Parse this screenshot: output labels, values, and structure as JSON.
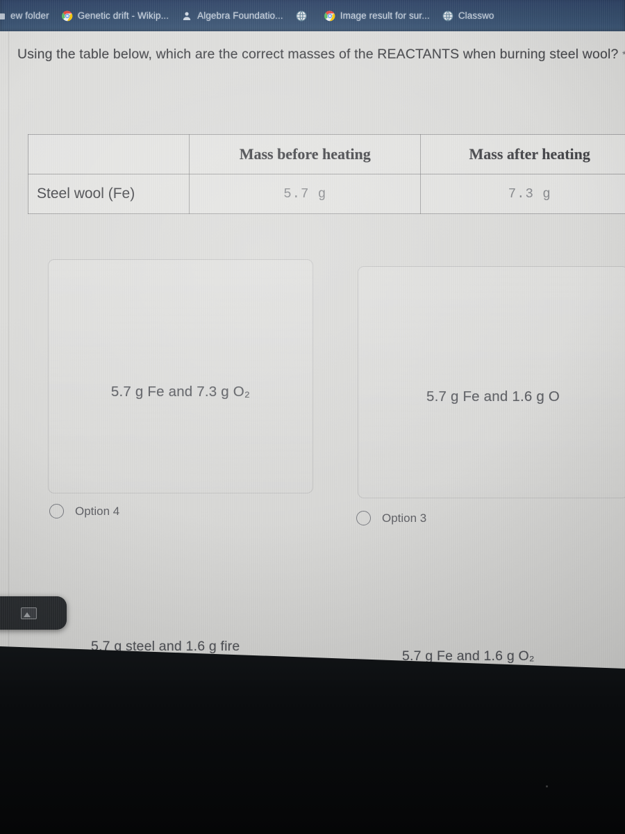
{
  "browser": {
    "bookmarks": [
      {
        "label": "ew folder",
        "icon": "folder-icon"
      },
      {
        "label": "Genetic drift - Wikip...",
        "icon": "chrome-icon"
      },
      {
        "label": "Algebra Foundatio...",
        "icon": "person-icon"
      },
      {
        "label": "",
        "icon": "globe-icon"
      },
      {
        "label": "Image result for sur...",
        "icon": "chrome-icon"
      },
      {
        "label": "Classwo",
        "icon": "globe-icon"
      }
    ]
  },
  "question": {
    "text": "Using the table below, which are the correct masses of the REACTANTS when burning steel wool?",
    "required_marker": "*"
  },
  "table": {
    "headers": [
      "",
      "Mass before heating",
      "Mass after heating"
    ],
    "rows": [
      {
        "label": "Steel wool (Fe)",
        "before": "5.7 g",
        "after": "7.3 g"
      }
    ]
  },
  "options": {
    "card_top_left": "5.7 g Fe and 7.3 g O₂",
    "card_top_right": "5.7 g Fe and 1.6 g O",
    "radio_left_label": "Option 4",
    "radio_right_label": "Option 3",
    "bottom_left": "5.7 g steel and 1.6 g fire",
    "bottom_right": "5.7 g Fe and 1.6 g O₂"
  },
  "overlay": {
    "chip_icon": "image-icon"
  },
  "colors": {
    "bookmarks_bar": "#2f4868",
    "bookmark_text": "#c9d2dd",
    "page_background": "#d9d9d7",
    "body_text": "#3f4044",
    "muted_text": "#7f8185",
    "dark_area": "#0b0d0f"
  }
}
